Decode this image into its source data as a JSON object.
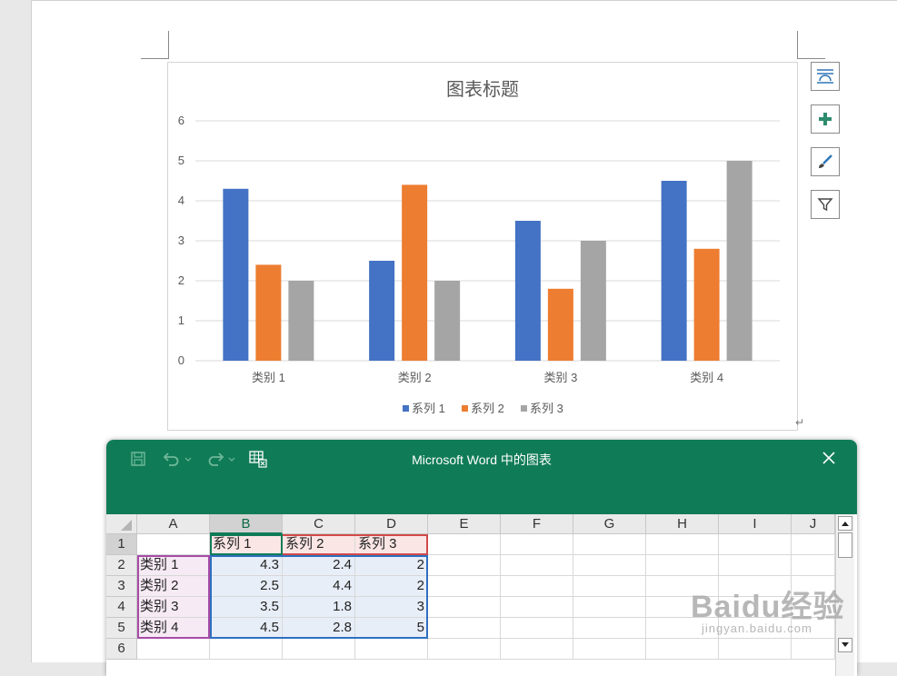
{
  "chart_data": {
    "type": "bar",
    "title": "图表标题",
    "categories": [
      "类别 1",
      "类别 2",
      "类别 3",
      "类别 4"
    ],
    "series": [
      {
        "name": "系列 1",
        "values": [
          4.3,
          2.5,
          3.5,
          4.5
        ],
        "color": "#4472c4"
      },
      {
        "name": "系列 2",
        "values": [
          2.4,
          4.4,
          1.8,
          2.8
        ],
        "color": "#ed7d31"
      },
      {
        "name": "系列 3",
        "values": [
          2,
          2,
          3,
          5
        ],
        "color": "#a5a5a5"
      }
    ],
    "ylim": [
      0,
      6
    ],
    "yticks": [
      "0",
      "1",
      "2",
      "3",
      "4",
      "5",
      "6"
    ],
    "grid": true,
    "legend": "bottom"
  },
  "chart_tools": [
    {
      "name": "layout-options-icon"
    },
    {
      "name": "chart-elements-icon"
    },
    {
      "name": "chart-styles-icon"
    },
    {
      "name": "chart-filters-icon"
    }
  ],
  "dialog": {
    "title": "Microsoft Word 中的图表",
    "accent": "#107c57",
    "quick_access": [
      "save-icon",
      "undo-icon",
      "redo-icon",
      "edit-data-in-excel-icon"
    ]
  },
  "spreadsheet": {
    "columns": [
      "A",
      "B",
      "C",
      "D",
      "E",
      "F",
      "G",
      "H",
      "I",
      "J"
    ],
    "rows": [
      "1",
      "2",
      "3",
      "4",
      "5",
      "6"
    ],
    "cells": [
      [
        "",
        "系列 1",
        "系列 2",
        "系列 3"
      ],
      [
        "类别 1",
        "4.3",
        "2.4",
        "2"
      ],
      [
        "类别 2",
        "2.5",
        "4.4",
        "2"
      ],
      [
        "类别 3",
        "3.5",
        "1.8",
        "3"
      ],
      [
        "类别 4",
        "4.5",
        "2.8",
        "5"
      ],
      [
        "",
        "",
        "",
        ""
      ]
    ]
  },
  "watermark": {
    "line1": "Baidu经验",
    "line2": "jingyan.baidu.com"
  }
}
